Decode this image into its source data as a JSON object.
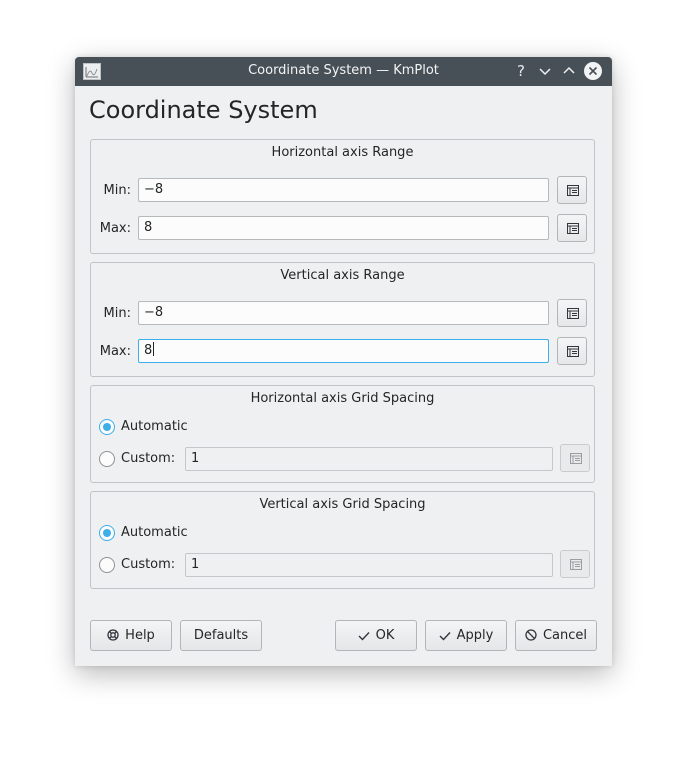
{
  "window": {
    "title": "Coordinate System — KmPlot",
    "heading": "Coordinate System",
    "help_glyph": "?"
  },
  "horizontal_range": {
    "title": "Horizontal axis Range",
    "min_label": "Min:",
    "min_value": "−8",
    "max_label": "Max:",
    "max_value": "8"
  },
  "vertical_range": {
    "title": "Vertical axis Range",
    "min_label": "Min:",
    "min_value": "−8",
    "max_label": "Max:",
    "max_value": "8"
  },
  "horizontal_grid": {
    "title": "Horizontal axis Grid Spacing",
    "automatic_label": "Automatic",
    "custom_label": "Custom:",
    "custom_value": "1",
    "selected": "automatic"
  },
  "vertical_grid": {
    "title": "Vertical axis Grid Spacing",
    "automatic_label": "Automatic",
    "custom_label": "Custom:",
    "custom_value": "1",
    "selected": "automatic"
  },
  "buttons": {
    "help": "Help",
    "defaults": "Defaults",
    "ok": "OK",
    "apply": "Apply",
    "cancel": "Cancel"
  },
  "colors": {
    "titlebar": "#475057",
    "accent": "#3daee9",
    "window_bg": "#eff0f1"
  }
}
